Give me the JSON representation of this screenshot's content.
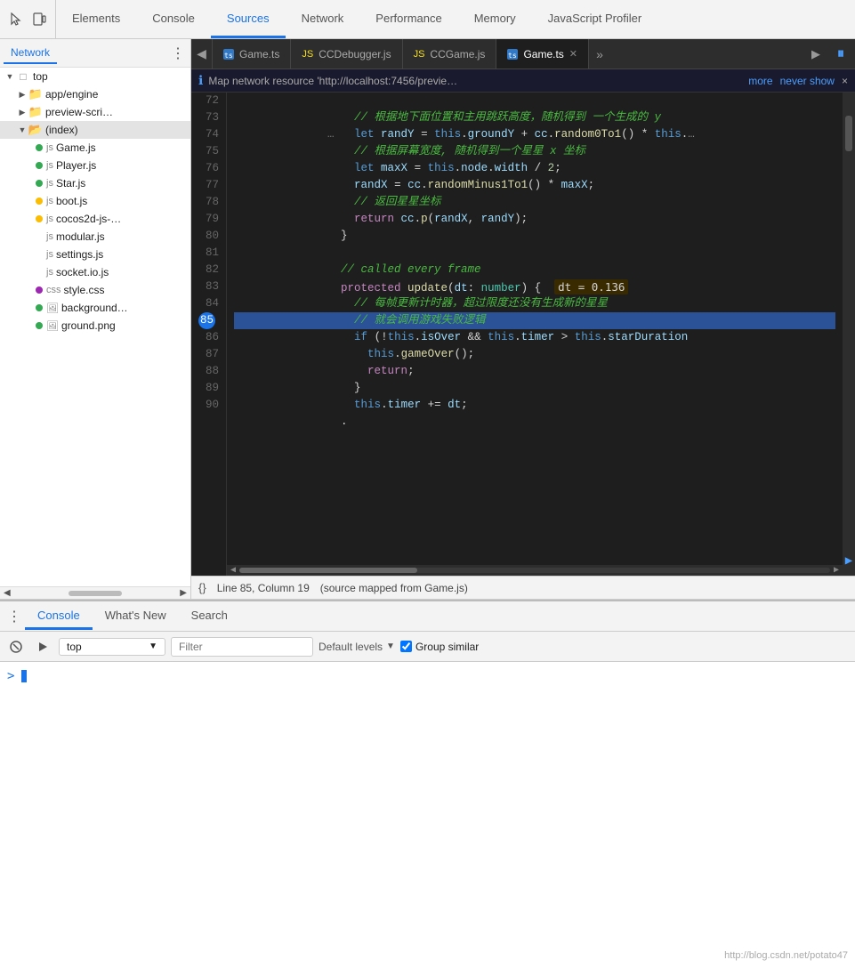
{
  "topbar": {
    "icons": [
      "cursor",
      "device"
    ],
    "tabs": [
      {
        "label": "Elements",
        "active": false
      },
      {
        "label": "Console",
        "active": false
      },
      {
        "label": "Sources",
        "active": true
      },
      {
        "label": "Network",
        "active": false
      },
      {
        "label": "Performance",
        "active": false
      },
      {
        "label": "Memory",
        "active": false
      },
      {
        "label": "JavaScript Profiler",
        "active": false
      }
    ]
  },
  "filetree": {
    "network_tab": "Network",
    "more_icon": "⋮",
    "items": [
      {
        "indent": 0,
        "type": "folder_root",
        "label": "top",
        "arrow": "▼",
        "expanded": true
      },
      {
        "indent": 1,
        "type": "folder",
        "label": "app/engine",
        "arrow": "▶",
        "expanded": false
      },
      {
        "indent": 1,
        "type": "folder_preview",
        "label": "preview-scri…",
        "arrow": "▶",
        "expanded": false
      },
      {
        "indent": 1,
        "type": "folder_open",
        "label": "(index)",
        "arrow": "▼",
        "expanded": true,
        "selected": false
      },
      {
        "indent": 2,
        "type": "file_js",
        "label": "Game.js",
        "dot": "green"
      },
      {
        "indent": 2,
        "type": "file_js",
        "label": "Player.js",
        "dot": "green"
      },
      {
        "indent": 2,
        "type": "file_js",
        "label": "Star.js",
        "dot": "green"
      },
      {
        "indent": 2,
        "type": "file_js",
        "label": "boot.js",
        "dot": "yellow"
      },
      {
        "indent": 2,
        "type": "file_js",
        "label": "cocos2d-js-…",
        "dot": "yellow"
      },
      {
        "indent": 2,
        "type": "file_js",
        "label": "modular.js"
      },
      {
        "indent": 2,
        "type": "file_js",
        "label": "settings.js"
      },
      {
        "indent": 2,
        "type": "file_js",
        "label": "socket.io.js"
      },
      {
        "indent": 2,
        "type": "file_css",
        "label": "style.css",
        "dot": "purple"
      },
      {
        "indent": 2,
        "type": "file_img",
        "label": "background…",
        "dot": "green"
      },
      {
        "indent": 2,
        "type": "file_img",
        "label": "ground.png",
        "dot": "green"
      }
    ]
  },
  "editor": {
    "tabs": [
      {
        "label": "Game.ts",
        "closable": false
      },
      {
        "label": "CCDebugger.js",
        "closable": false
      },
      {
        "label": "CCGame.js",
        "closable": false
      },
      {
        "label": "Game.ts",
        "closable": true,
        "active": true
      }
    ],
    "info_bar": {
      "text": "Map network resource 'http://localhost:7456/previe…",
      "more": "more",
      "never_show": "never show",
      "close": "×"
    },
    "lines": [
      {
        "num": 72,
        "content": "    // 根据地下面位置和主用跳跃高度，随机得到 一个生成的 y",
        "type": "comment"
      },
      {
        "num": 73,
        "content": "    let randY = this.groundY + cc.random0To1() * this.",
        "type": "code"
      },
      {
        "num": 74,
        "content": "    // 根据屏幕宽度, 随机得到一个星星 x 坐标",
        "type": "comment"
      },
      {
        "num": 75,
        "content": "    let maxX = this.node.width / 2;",
        "type": "code"
      },
      {
        "num": 76,
        "content": "    randX = cc.randomMinus1To1() * maxX;",
        "type": "code"
      },
      {
        "num": 77,
        "content": "    // 返回星星坐标",
        "type": "comment"
      },
      {
        "num": 78,
        "content": "    return cc.p(randX, randY);",
        "type": "code"
      },
      {
        "num": 79,
        "content": "  }",
        "type": "code"
      },
      {
        "num": 80,
        "content": "",
        "type": "blank"
      },
      {
        "num": 81,
        "content": "  // called every frame",
        "type": "italic_comment"
      },
      {
        "num": 82,
        "content": "  protected update(dt: number) {    dt = 0.136",
        "type": "code_highlight"
      },
      {
        "num": 83,
        "content": "    // 每帧更新计时器，超过限度还没有生成新的星星",
        "type": "comment"
      },
      {
        "num": 84,
        "content": "    // 就会调用游戏失败逻辑",
        "type": "comment"
      },
      {
        "num": 85,
        "content": "    if (!this.isOver && this.timer > this.starDuration",
        "type": "code_breakpoint"
      },
      {
        "num": 86,
        "content": "      this.gameOver();",
        "type": "code"
      },
      {
        "num": 87,
        "content": "      return;",
        "type": "code"
      },
      {
        "num": 88,
        "content": "    }",
        "type": "code"
      },
      {
        "num": 89,
        "content": "    this.timer += dt;",
        "type": "code"
      },
      {
        "num": 90,
        "content": "  .",
        "type": "code"
      }
    ],
    "status_bar": {
      "line": "Line 85, Column 19",
      "source": "(source mapped from Game.js)"
    }
  },
  "console_panel": {
    "tabs": [
      {
        "label": "Console",
        "active": true
      },
      {
        "label": "What's New",
        "active": false
      },
      {
        "label": "Search",
        "active": false
      }
    ],
    "toolbar": {
      "context_label": "top",
      "filter_placeholder": "Filter",
      "levels_label": "Default levels",
      "group_similar": "Group similar"
    },
    "prompt_symbol": ">"
  },
  "watermark": "http://blog.csdn.net/potato47"
}
